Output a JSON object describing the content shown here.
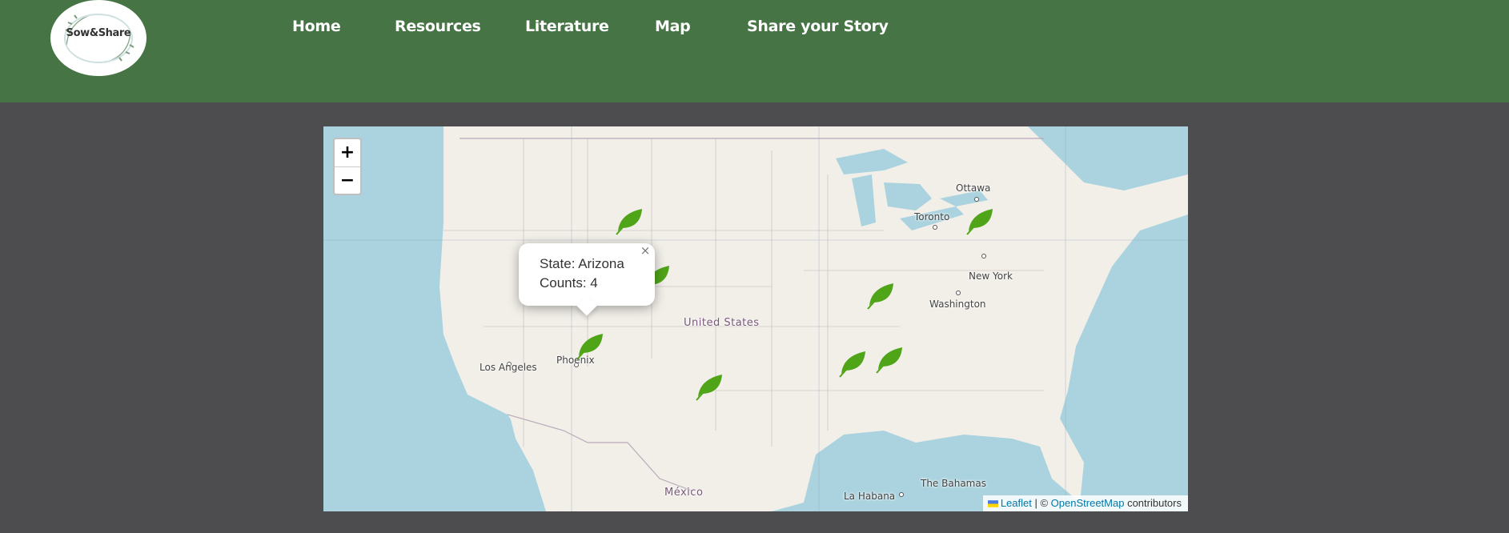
{
  "brand": {
    "logo_text": "Sow&Share"
  },
  "nav": {
    "items": [
      "Home",
      "Resources",
      "Literature",
      "Map",
      "Share your Story"
    ]
  },
  "map": {
    "zoom_in": "+",
    "zoom_out": "−",
    "popup": {
      "state_line": "State: Arizona",
      "counts_line": "Counts: 4",
      "close": "×"
    },
    "labels": {
      "ottawa": "Ottawa",
      "toronto": "Toronto",
      "new_york": "New York",
      "washington": "Washington",
      "united_states": "United States",
      "phoenix": "Phoenix",
      "los_angeles": "Los Angeles",
      "mexico": "México",
      "la_habana": "La Habana",
      "bahamas": "The Bahamas"
    },
    "attribution": {
      "leaflet": "Leaflet",
      "sep": " | © ",
      "osm": "OpenStreetMap",
      "tail": " contributors"
    },
    "marker_icon": "leaf-icon",
    "marker_count": 9,
    "colors": {
      "header": "#467445",
      "background": "#4d4c4f",
      "water": "#aad3df",
      "land": "#f2efe9",
      "leaf": "#4fa418"
    }
  }
}
